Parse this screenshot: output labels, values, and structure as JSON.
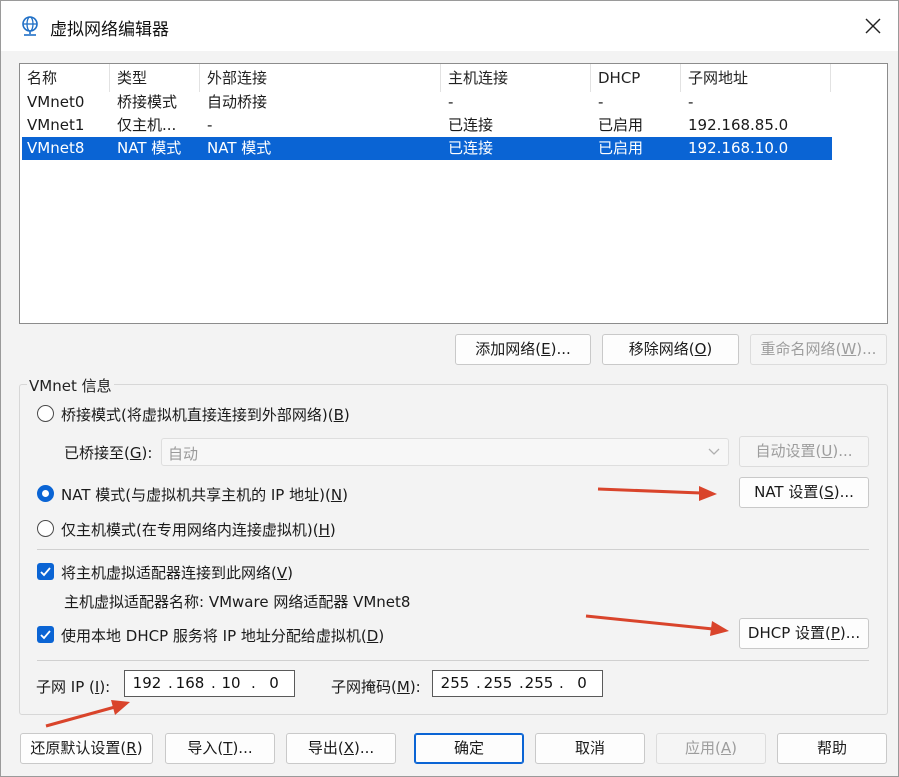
{
  "window": {
    "title": "虚拟网络编辑器",
    "icon": "globe-network-icon",
    "close_icon": "close-icon"
  },
  "list": {
    "columns": [
      "名称",
      "类型",
      "外部连接",
      "主机连接",
      "DHCP",
      "子网地址"
    ],
    "rows": [
      {
        "name": "VMnet0",
        "type": "桥接模式",
        "external": "自动桥接",
        "host": "-",
        "dhcp": "-",
        "subnet": "-",
        "selected": false
      },
      {
        "name": "VMnet1",
        "type": "仅主机...",
        "external": "-",
        "host": "已连接",
        "dhcp": "已启用",
        "subnet": "192.168.85.0",
        "selected": false
      },
      {
        "name": "VMnet8",
        "type": "NAT 模式",
        "external": "NAT 模式",
        "host": "已连接",
        "dhcp": "已启用",
        "subnet": "192.168.10.0",
        "selected": true
      }
    ]
  },
  "list_buttons": {
    "add": {
      "label": "添加网络",
      "key": "E",
      "suffix": "..."
    },
    "remove": {
      "label": "移除网络",
      "key": "O",
      "suffix": ""
    },
    "rename": {
      "label": "重命名网络",
      "key": "W",
      "suffix": "..."
    }
  },
  "vmnet_info": {
    "title": "VMnet 信息",
    "bridged": {
      "label": "桥接模式(将虚拟机直接连接到外部网络)",
      "key": "B",
      "checked": false
    },
    "bridged_to": {
      "label": "已桥接至",
      "key": "G",
      "value": "自动"
    },
    "auto_settings": {
      "label": "自动设置",
      "key": "U",
      "suffix": "..."
    },
    "nat": {
      "label": "NAT 模式(与虚拟机共享主机的 IP 地址)",
      "key": "N",
      "checked": true
    },
    "nat_settings": {
      "label": "NAT 设置",
      "key": "S",
      "suffix": "..."
    },
    "hostonly": {
      "label": "仅主机模式(在专用网络内连接虚拟机)",
      "key": "H",
      "checked": false
    },
    "connect_adapter": {
      "label": "将主机虚拟适配器连接到此网络",
      "key": "V",
      "checked": true
    },
    "adapter_name": "主机虚拟适配器名称: VMware 网络适配器 VMnet8",
    "use_dhcp": {
      "label": "使用本地 DHCP 服务将 IP 地址分配给虚拟机",
      "key": "D",
      "checked": true
    },
    "dhcp_settings": {
      "label": "DHCP 设置",
      "key": "P",
      "suffix": "..."
    },
    "subnet_ip": {
      "label": "子网 IP",
      "key": "I",
      "octets": [
        "192",
        "168",
        "10",
        "0"
      ]
    },
    "subnet_mask": {
      "label": "子网掩码",
      "key": "M",
      "octets": [
        "255",
        "255",
        "255",
        "0"
      ]
    }
  },
  "footer": {
    "restore": {
      "label": "还原默认设置",
      "key": "R",
      "suffix": ""
    },
    "import": {
      "label": "导入",
      "key": "T",
      "suffix": "..."
    },
    "export": {
      "label": "导出",
      "key": "X",
      "suffix": "..."
    },
    "ok": "确定",
    "cancel": "取消",
    "apply": {
      "label": "应用",
      "key": "A",
      "suffix": ""
    },
    "help": "帮助"
  },
  "annotation_color": "#d9442b",
  "accent_color": "#0a64d4"
}
